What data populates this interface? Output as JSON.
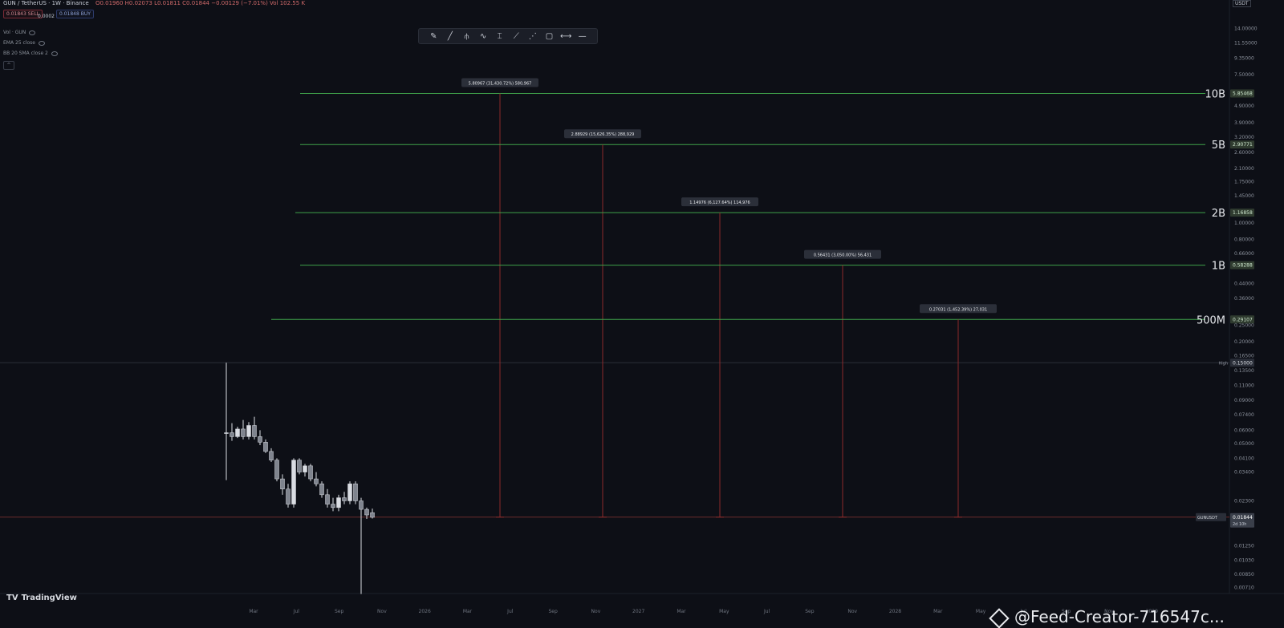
{
  "header": {
    "symbol": "GUN / TetherUS · 1W · Binance",
    "ohlc": "O0.01960 H0.02073 L0.01811 C0.01844 −0.00129 (−7.01%) Vol 102.55 K",
    "sell_badge": "0.01843 SELL",
    "buy_badge": "0.01848 BUY",
    "spread": "0.0002",
    "indicators": [
      "Vol · GUN",
      "EMA 25 close",
      "BB 20 SMA close 2"
    ],
    "collapse": "^"
  },
  "toolbar": {
    "tools": [
      "pencil-icon",
      "line-icon",
      "fork-icon",
      "wave-icon",
      "text-cursor-icon",
      "brush-icon",
      "path-icon",
      "rectangle-icon",
      "range-icon",
      "minus-icon"
    ],
    "glyphs": [
      "✎",
      "╱",
      "⫛",
      "∿",
      "⌶",
      "⟋",
      "⋰",
      "▢",
      "⟷",
      "—"
    ]
  },
  "branding": {
    "logo_text": "TV",
    "name": "TradingView"
  },
  "watermark": "@Feed-Creator-716547c...",
  "chart_data": {
    "type": "candlestick",
    "yscale": "log",
    "ylim": [
      0.00654,
      18.5
    ],
    "currency": "USDT",
    "y_ticks": [
      14.0,
      11.55,
      9.35,
      7.5,
      4.9,
      3.9,
      3.2,
      2.6,
      2.1,
      1.75,
      1.45,
      1.0,
      0.8,
      0.66,
      0.44,
      0.36,
      0.25,
      0.2,
      0.165,
      0.135,
      0.11,
      0.09,
      0.074,
      0.06,
      0.05,
      0.041,
      0.034,
      0.023,
      0.0125,
      0.0103,
      0.0085,
      0.0071
    ],
    "x_labels": [
      "Mar",
      "Jul",
      "Sep",
      "Nov",
      "2026",
      "Mar",
      "Jul",
      "Sep",
      "Nov",
      "2027",
      "Mar",
      "May",
      "Jul",
      "Sep",
      "Nov",
      "2028",
      "Mar",
      "May",
      "Jul",
      "Sep",
      "Nov",
      "2029"
    ],
    "current_price": 0.01844,
    "current_label": "GUNUSDT",
    "countdown": "2d 10h",
    "high": {
      "label": "High",
      "value": 0.15
    },
    "low_value": 0.00654,
    "levels": [
      {
        "name": "10B",
        "price": 5.8,
        "label": "5.80967 (31,430.72%) 580,967",
        "axis": "5.85468"
      },
      {
        "name": "5B",
        "price": 2.9,
        "label": "2.88929 (15,626.35%) 288,929",
        "axis": "2.90771"
      },
      {
        "name": "2B",
        "price": 1.15,
        "label": "1.14976 (6,127.64%) 114,976",
        "axis": "1.16858"
      },
      {
        "name": "1B",
        "price": 0.564,
        "label": "0.56431 (3,050.00%) 56,431",
        "axis": "0.58288"
      },
      {
        "name": "500M",
        "price": 0.27,
        "label": "0.27031 (1,452.39%) 27,031",
        "axis": "0.29107"
      }
    ],
    "candles": [
      {
        "o": 0.058,
        "h": 0.15,
        "l": 0.0305,
        "c": 0.058
      },
      {
        "o": 0.058,
        "h": 0.066,
        "l": 0.052,
        "c": 0.055
      },
      {
        "o": 0.055,
        "h": 0.063,
        "l": 0.054,
        "c": 0.061
      },
      {
        "o": 0.061,
        "h": 0.069,
        "l": 0.053,
        "c": 0.055
      },
      {
        "o": 0.055,
        "h": 0.067,
        "l": 0.053,
        "c": 0.064
      },
      {
        "o": 0.064,
        "h": 0.072,
        "l": 0.053,
        "c": 0.055
      },
      {
        "o": 0.055,
        "h": 0.06,
        "l": 0.049,
        "c": 0.051
      },
      {
        "o": 0.051,
        "h": 0.053,
        "l": 0.044,
        "c": 0.045
      },
      {
        "o": 0.045,
        "h": 0.047,
        "l": 0.039,
        "c": 0.04
      },
      {
        "o": 0.04,
        "h": 0.041,
        "l": 0.03,
        "c": 0.031
      },
      {
        "o": 0.031,
        "h": 0.033,
        "l": 0.025,
        "c": 0.027
      },
      {
        "o": 0.027,
        "h": 0.029,
        "l": 0.021,
        "c": 0.022
      },
      {
        "o": 0.022,
        "h": 0.041,
        "l": 0.021,
        "c": 0.04
      },
      {
        "o": 0.04,
        "h": 0.041,
        "l": 0.033,
        "c": 0.034
      },
      {
        "o": 0.034,
        "h": 0.038,
        "l": 0.032,
        "c": 0.037
      },
      {
        "o": 0.037,
        "h": 0.038,
        "l": 0.03,
        "c": 0.031
      },
      {
        "o": 0.031,
        "h": 0.034,
        "l": 0.028,
        "c": 0.029
      },
      {
        "o": 0.029,
        "h": 0.03,
        "l": 0.024,
        "c": 0.025
      },
      {
        "o": 0.025,
        "h": 0.027,
        "l": 0.021,
        "c": 0.022
      },
      {
        "o": 0.022,
        "h": 0.024,
        "l": 0.02,
        "c": 0.021
      },
      {
        "o": 0.021,
        "h": 0.025,
        "l": 0.02,
        "c": 0.024
      },
      {
        "o": 0.024,
        "h": 0.026,
        "l": 0.022,
        "c": 0.023
      },
      {
        "o": 0.023,
        "h": 0.03,
        "l": 0.022,
        "c": 0.029
      },
      {
        "o": 0.029,
        "h": 0.03,
        "l": 0.022,
        "c": 0.023
      },
      {
        "o": 0.023,
        "h": 0.024,
        "l": 0.0065,
        "c": 0.0205
      },
      {
        "o": 0.0205,
        "h": 0.021,
        "l": 0.018,
        "c": 0.019
      },
      {
        "o": 0.0196,
        "h": 0.0207,
        "l": 0.0181,
        "c": 0.0184
      }
    ]
  },
  "colors": {
    "background": "#0d0f16",
    "level_line": "#3fa14a",
    "projection_line": "#8c2a2a",
    "price_line": "#6b2b2b",
    "candle": "#d9dce2"
  }
}
